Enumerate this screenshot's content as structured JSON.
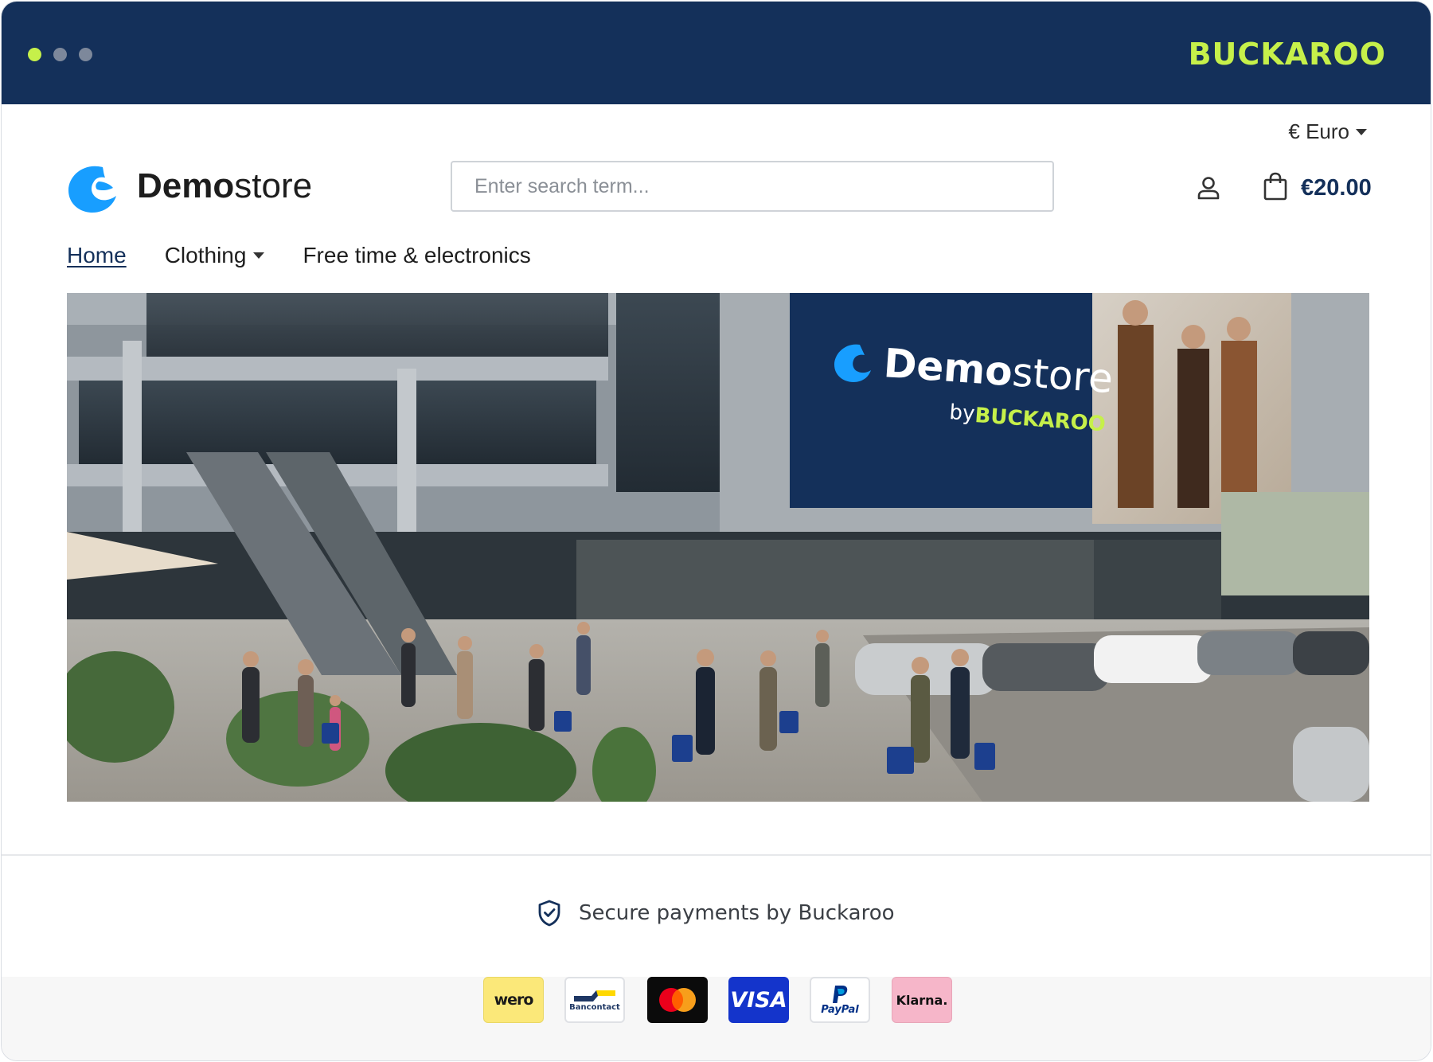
{
  "window": {
    "brand": "BUCKAROO",
    "colors": {
      "bar": "#14305a",
      "accent": "#c6f04a",
      "dot_inactive": "#7d889b"
    }
  },
  "header": {
    "currency": "€ Euro",
    "store_name_bold": "Demo",
    "store_name_rest": "store",
    "search_placeholder": "Enter search term...",
    "cart_total": "€20.00",
    "icons": {
      "logo": "demostore-logo",
      "account": "user-icon",
      "cart": "shopping-bag-icon"
    }
  },
  "nav": {
    "items": [
      {
        "label": "Home",
        "active": true
      },
      {
        "label": "Clothing",
        "has_dropdown": true
      },
      {
        "label": "Free time & electronics"
      }
    ]
  },
  "hero": {
    "billboard_title_bold": "Demo",
    "billboard_title_rest": "store",
    "billboard_by": "by",
    "billboard_brand": "BUCKAROO"
  },
  "footer": {
    "secure_text": "Secure payments by Buckaroo",
    "payment_methods": [
      {
        "name": "wero",
        "label": "wero"
      },
      {
        "name": "bancontact",
        "label": "Bancontact"
      },
      {
        "name": "mastercard",
        "label": ""
      },
      {
        "name": "visa",
        "label": "VISA"
      },
      {
        "name": "paypal",
        "label": "PayPal"
      },
      {
        "name": "klarna",
        "label": "Klarna."
      }
    ]
  }
}
